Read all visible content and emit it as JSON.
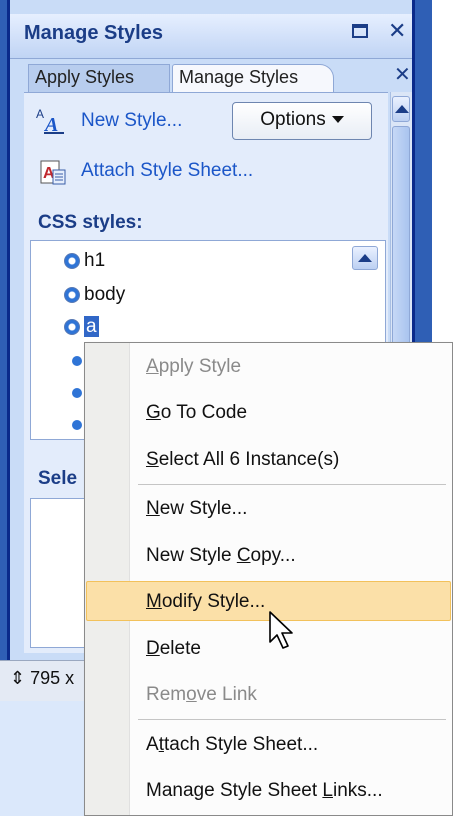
{
  "panel": {
    "title": "Manage Styles",
    "tabs": [
      {
        "label": "Apply Styles",
        "active": false
      },
      {
        "label": "Manage Styles",
        "active": true
      }
    ]
  },
  "toolbar": {
    "new_style_label": "New Style...",
    "options_label": "Options",
    "attach_label": "Attach Style Sheet..."
  },
  "css_styles": {
    "heading": "CSS styles:",
    "items": [
      {
        "name": "h1",
        "selected": false
      },
      {
        "name": "body",
        "selected": false
      },
      {
        "name": "a",
        "selected": true
      }
    ]
  },
  "selected_preview": {
    "heading_partial": "Sele"
  },
  "status_bar": {
    "text": "795 x"
  },
  "context_menu": {
    "items": [
      {
        "pre": "",
        "key": "A",
        "post": "pply Style",
        "disabled": true
      },
      {
        "pre": "",
        "key": "G",
        "post": "o To Code",
        "disabled": false
      },
      {
        "pre": "",
        "key": "S",
        "post": "elect All 6 Instance(s)",
        "disabled": false
      },
      {
        "pre": "",
        "key": "N",
        "post": "ew Style...",
        "disabled": false
      },
      {
        "pre": "New Style ",
        "key": "C",
        "post": "opy...",
        "disabled": false
      },
      {
        "pre": "",
        "key": "M",
        "post": "odify Style...",
        "disabled": false,
        "highlighted": true
      },
      {
        "pre": "",
        "key": "D",
        "post": "elete",
        "disabled": false
      },
      {
        "pre": "Rem",
        "key": "o",
        "post": "ve Link",
        "disabled": true
      },
      {
        "pre": "A",
        "key": "t",
        "post": "tach Style Sheet...",
        "disabled": false
      },
      {
        "pre": "Manage Style Sheet ",
        "key": "L",
        "post": "inks...",
        "disabled": false
      }
    ]
  },
  "colors": {
    "accent_title": "#1b3d87",
    "link": "#1b56c8",
    "highlight": "#fbe0a8",
    "selection": "#3167c7"
  }
}
